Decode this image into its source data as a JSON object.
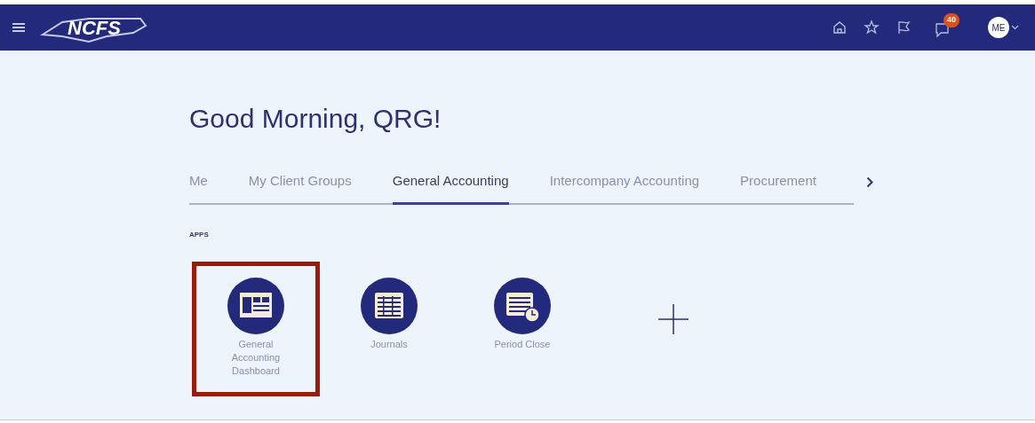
{
  "header": {
    "logo_text": "NCFS",
    "notifications_count": "40",
    "avatar_initials": "ME"
  },
  "greeting": "Good Morning, QRG!",
  "tabs": [
    {
      "label": "Me",
      "selected": false
    },
    {
      "label": "My Client Groups",
      "selected": false
    },
    {
      "label": "General Accounting",
      "selected": true
    },
    {
      "label": "Intercompany Accounting",
      "selected": false
    },
    {
      "label": "Procurement",
      "selected": false
    }
  ],
  "section_label": "APPS",
  "apps": [
    {
      "kind": "dashboard",
      "label": "General Accounting Dashboard",
      "highlighted": true
    },
    {
      "kind": "journals",
      "label": "Journals",
      "highlighted": false
    },
    {
      "kind": "period_close",
      "label": "Period Close",
      "highlighted": false
    }
  ]
}
